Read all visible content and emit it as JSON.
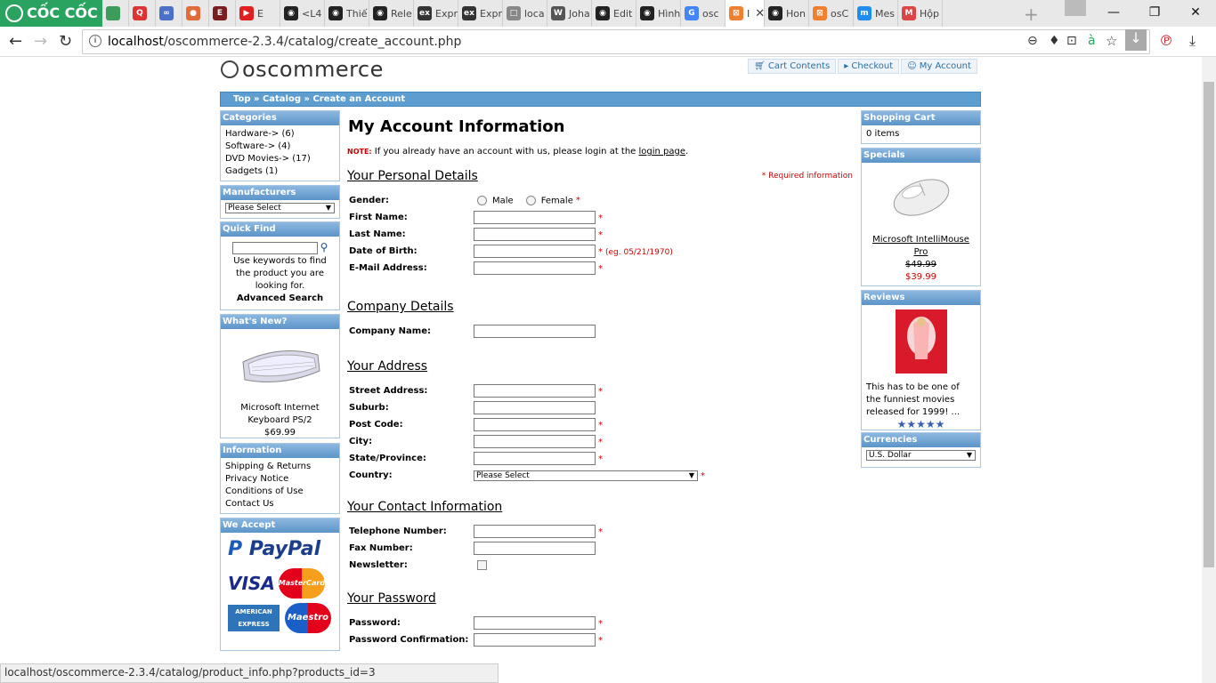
{
  "browser": {
    "brand": "CỐC CỐC",
    "tabs": [
      {
        "fav": "",
        "color": "#3d9b5c",
        "label": ""
      },
      {
        "fav": "Q",
        "color": "#d33",
        "label": ""
      },
      {
        "fav": "∞",
        "color": "#4a70c7",
        "label": ""
      },
      {
        "fav": "●",
        "color": "#e26b3a",
        "label": ""
      },
      {
        "fav": "E",
        "color": "#7a1f1f",
        "label": ""
      },
      {
        "fav": "▶",
        "color": "#e02020",
        "label": "E"
      },
      {
        "fav": "◉",
        "color": "#222",
        "label": "<L4"
      },
      {
        "fav": "◉",
        "color": "#222",
        "label": "Thiế"
      },
      {
        "fav": "◉",
        "color": "#222",
        "label": "Rele"
      },
      {
        "fav": "ex",
        "color": "#333",
        "label": "Expr"
      },
      {
        "fav": "ex",
        "color": "#333",
        "label": "Expr"
      },
      {
        "fav": "□",
        "color": "#888",
        "label": "loca"
      },
      {
        "fav": "W",
        "color": "#555",
        "label": "Joha"
      },
      {
        "fav": "◉",
        "color": "#222",
        "label": "Edit"
      },
      {
        "fav": "◉",
        "color": "#222",
        "label": "Hình"
      },
      {
        "fav": "G",
        "color": "#4285f4",
        "label": "osc"
      },
      {
        "fav": "⊠",
        "color": "#f08030",
        "label": "I",
        "active": true
      },
      {
        "fav": "◉",
        "color": "#222",
        "label": "Hon"
      },
      {
        "fav": "⊠",
        "color": "#f08030",
        "label": "osC"
      },
      {
        "fav": "m",
        "color": "#1f8cf0",
        "label": "Mes"
      },
      {
        "fav": "M",
        "color": "#d44",
        "label": "Hộp"
      }
    ],
    "url_prefix": "localhost",
    "url_rest": "/oscommerce-2.3.4/catalog/create_account.php",
    "status": "localhost/oscommerce-2.3.4/catalog/product_info.php?products_id=3"
  },
  "site": {
    "logo": "oscommerce",
    "cart_contents": "Cart Contents",
    "checkout": "Checkout",
    "my_account": "My Account",
    "breadcrumb": "Top » Catalog » Create an Account"
  },
  "left": {
    "categories_title": "Categories",
    "categories": [
      "Hardware-> (6)",
      "Software-> (4)",
      "DVD Movies-> (17)",
      "Gadgets (1)"
    ],
    "manufacturers_title": "Manufacturers",
    "manufacturers_select": "Please Select",
    "quickfind_title": "Quick Find",
    "quickfind_text": "Use keywords to find the product you are looking for.",
    "advanced_search": "Advanced Search",
    "whatsnew_title": "What's New?",
    "whatsnew_name": "Microsoft Internet Keyboard PS/2",
    "whatsnew_price": "$69.99",
    "information_title": "Information",
    "information": [
      "Shipping & Returns",
      "Privacy Notice",
      "Conditions of Use",
      "Contact Us"
    ],
    "weaccept_title": "We Accept",
    "paypal": "PayPal",
    "visa": "VISA",
    "mastercard": "MasterCard",
    "amex": "AMERICAN EXPRESS",
    "maestro": "Maestro"
  },
  "main": {
    "title": "My Account Information",
    "note_label": "NOTE:",
    "note_text": " If you already have an account with us, please login at the ",
    "note_link": "login page",
    "note_end": ".",
    "required": "* Required information",
    "personal_head": "Your Personal Details",
    "gender": "Gender:",
    "male": "Male",
    "female": "Female",
    "first_name": "First Name:",
    "last_name": "Last Name:",
    "dob": "Date of Birth:",
    "dob_hint": "(eg. 05/21/1970)",
    "email": "E-Mail Address:",
    "company_head": "Company Details",
    "company_name": "Company Name:",
    "address_head": "Your Address",
    "street": "Street Address:",
    "suburb": "Suburb:",
    "postcode": "Post Code:",
    "city": "City:",
    "state": "State/Province:",
    "country": "Country:",
    "country_select": "Please Select",
    "contact_head": "Your Contact Information",
    "telephone": "Telephone Number:",
    "fax": "Fax Number:",
    "newsletter": "Newsletter:",
    "password_head": "Your Password",
    "password": "Password:",
    "password_confirm": "Password Confirmation:"
  },
  "right": {
    "cart_title": "Shopping Cart",
    "cart_items": "0 items",
    "specials_title": "Specials",
    "special_name": "Microsoft IntelliMouse Pro",
    "special_old": "$49.99",
    "special_new": "$39.99",
    "reviews_title": "Reviews",
    "review_text": "This has to be one of the funniest movies released for 1999! ...",
    "review_stars": "★★★★★",
    "currencies_title": "Currencies",
    "currency": "U.S. Dollar"
  }
}
